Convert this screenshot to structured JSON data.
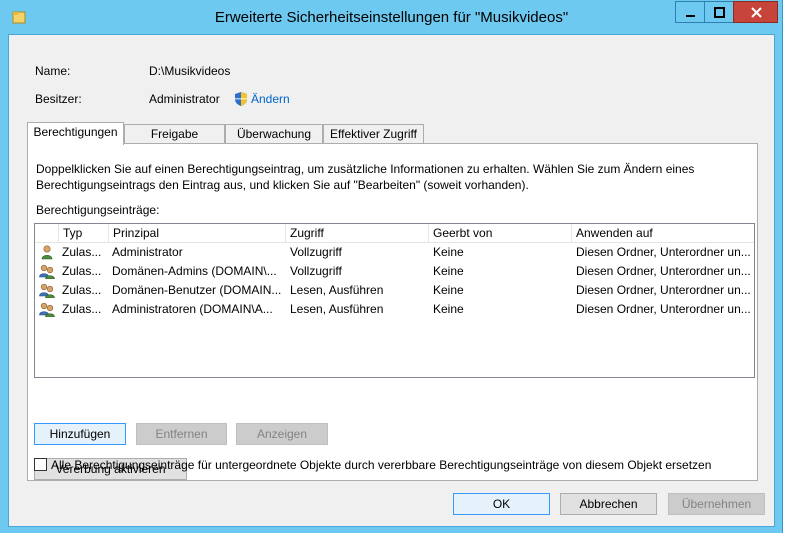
{
  "window": {
    "title": "Erweiterte Sicherheitseinstellungen für \"Musikvideos\"",
    "accent": "#6ec9f0",
    "close_color": "#c7443b"
  },
  "info": {
    "name_label": "Name:",
    "name_value": "D:\\Musikvideos",
    "owner_label": "Besitzer:",
    "owner_value": "Administrator",
    "change_link": "Ändern"
  },
  "tabs": [
    {
      "label": "Berechtigungen",
      "active": true
    },
    {
      "label": "Freigabe",
      "active": false
    },
    {
      "label": "Überwachung",
      "active": false
    },
    {
      "label": "Effektiver Zugriff",
      "active": false
    }
  ],
  "panel": {
    "description": "Doppelklicken Sie auf einen Berechtigungseintrag, um zusätzliche Informationen zu erhalten. Wählen Sie zum Ändern eines Berechtigungseintrags den Eintrag aus, und klicken Sie auf \"Bearbeiten\" (soweit vorhanden).",
    "entries_label": "Berechtigungseinträge:",
    "columns": [
      "Typ",
      "Prinzipal",
      "Zugriff",
      "Geerbt von",
      "Anwenden auf"
    ],
    "rows": [
      {
        "icon": "user-icon",
        "type": "Zulas...",
        "principal": "Administrator",
        "access": "Vollzugriff",
        "inherited": "Keine",
        "applies": "Diesen Ordner, Unterordner un..."
      },
      {
        "icon": "group-icon",
        "type": "Zulas...",
        "principal": "Domänen-Admins (DOMAIN\\...",
        "access": "Vollzugriff",
        "inherited": "Keine",
        "applies": "Diesen Ordner, Unterordner un..."
      },
      {
        "icon": "group-icon",
        "type": "Zulas...",
        "principal": "Domänen-Benutzer (DOMAIN...",
        "access": "Lesen, Ausführen",
        "inherited": "Keine",
        "applies": "Diesen Ordner, Unterordner un..."
      },
      {
        "icon": "group-icon",
        "type": "Zulas...",
        "principal": "Administratoren (DOMAIN\\A...",
        "access": "Lesen, Ausführen",
        "inherited": "Keine",
        "applies": "Diesen Ordner, Unterordner un..."
      }
    ],
    "add_button": "Hinzufügen",
    "remove_button": "Entfernen",
    "view_button": "Anzeigen",
    "inherit_button": "Vererbung aktivieren"
  },
  "replace_checkbox": {
    "label": "Alle Berechtigungseinträge für untergeordnete Objekte durch vererbbare Berechtigungseinträge von diesem Objekt ersetzen",
    "checked": false
  },
  "footer": {
    "ok": "OK",
    "cancel": "Abbrechen",
    "apply": "Übernehmen"
  }
}
